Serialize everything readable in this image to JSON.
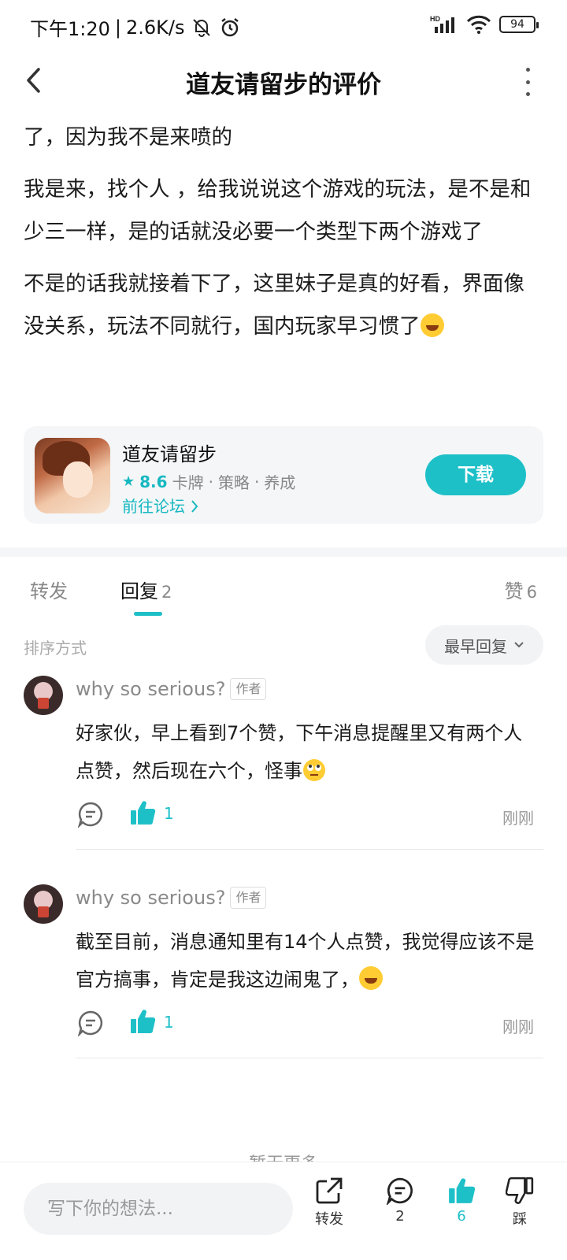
{
  "status_bar": {
    "time": "下午1:20",
    "speed": "2.6K/s",
    "battery": "94",
    "network": "HD"
  },
  "header": {
    "title": "道友请留步的评价"
  },
  "post": {
    "paragraphs": [
      "了，因为我不是来喷的",
      "我是来，找个人 ，给我说说这个游戏的玩法，是不是和少三一样，是的话就没必要一个类型下两个游戏了",
      "不是的话我就接着下了，这里妹子是真的好看，界面像没关系，玩法不同就行，国内玩家早习惯了"
    ],
    "emoji": "laughing-tears"
  },
  "game_card": {
    "name": "道友请留步",
    "score": "8.6",
    "tags": [
      "卡牌",
      "策略",
      "养成"
    ],
    "tag_separator": "·",
    "forum_link": "前往论坛",
    "download_label": "下载"
  },
  "tabs": {
    "repost_label": "转发",
    "reply_label": "回复",
    "reply_count": "2",
    "like_label": "赞",
    "like_count": "6"
  },
  "sort": {
    "label": "排序方式",
    "selected": "最早回复"
  },
  "comments": [
    {
      "author": "why so serious?",
      "badge": "作者",
      "text": "好家伙，早上看到7个赞，下午消息提醒里又有两个人点赞，然后现在六个，怪事",
      "emoji": "eye-roll",
      "likes": "1",
      "time": "刚刚"
    },
    {
      "author": "why so serious?",
      "badge": "作者",
      "text": "截至目前，消息通知里有14个人点赞，我觉得应该不是官方搞事，肯定是我这边闹鬼了，",
      "emoji": "laughing-tears",
      "likes": "1",
      "time": "刚刚"
    }
  ],
  "no_more": "暂无更多",
  "bottom_bar": {
    "input_placeholder": "写下你的想法...",
    "repost_label": "转发",
    "comment_count": "2",
    "like_count": "6",
    "dislike_label": "踩"
  },
  "colors": {
    "accent": "#1ec0c8",
    "muted_text": "#888888",
    "card_bg": "#f4f6f8"
  }
}
